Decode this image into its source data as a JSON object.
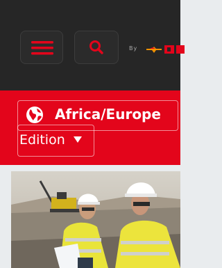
{
  "header": {
    "menu_icon": "hamburger-menu-icon",
    "search_icon": "search-icon",
    "byline": "By",
    "brand_logo": "sandvik-logo",
    "accent_color": "#e3051b",
    "background_color": "#262626"
  },
  "edition": {
    "region": "Africa/Europe",
    "label": "Edition",
    "region_icon": "globe-icon",
    "dropdown_icon": "caret-down-icon",
    "background_color": "#e3051b"
  },
  "hero": {
    "image": "mine-workers-photo"
  }
}
